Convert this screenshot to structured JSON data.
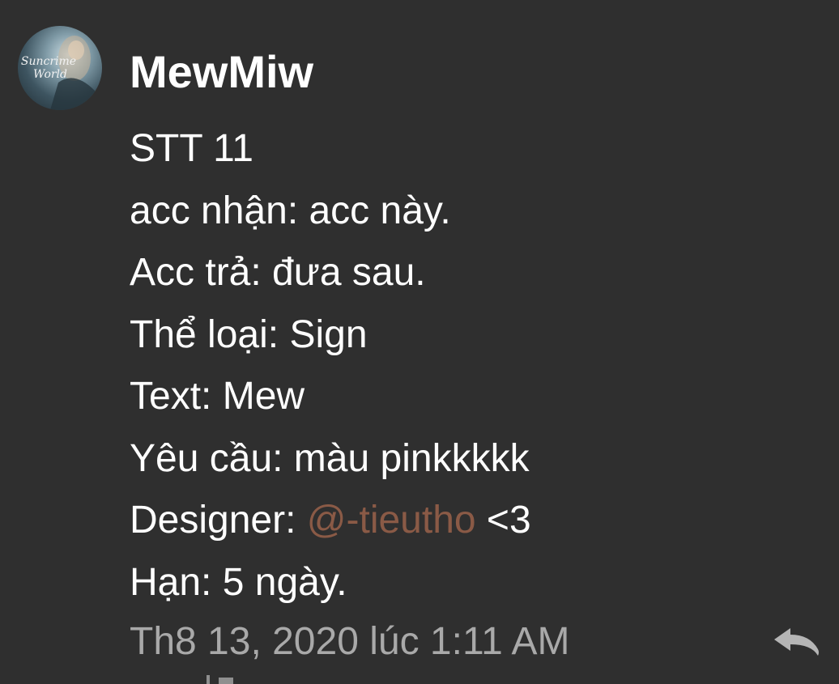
{
  "comment": {
    "author": "MewMiw",
    "avatar_text": [
      "Suncrime",
      "World"
    ],
    "lines": {
      "l1": "STT 11",
      "l2": "acc nhận: acc này.",
      "l3": "Acc trả: đưa sau.",
      "l4": "Thể loại: Sign",
      "l5": "Text: Mew",
      "l6": "Yêu cầu: màu pinkkkkk",
      "l7_prefix": "Designer: ",
      "l7_mention": "@-tieutho",
      "l7_suffix": " <3",
      "l8": "Hạn: 5 ngày."
    },
    "timestamp": "Th8 13, 2020 lúc 1:11 AM",
    "reply_icon": "reply-icon"
  },
  "colors": {
    "background": "#2f2f2f",
    "text": "#ffffff",
    "mention": "#8a5a46",
    "timestamp": "#a9a9a9",
    "icon": "#b5b5b5"
  }
}
